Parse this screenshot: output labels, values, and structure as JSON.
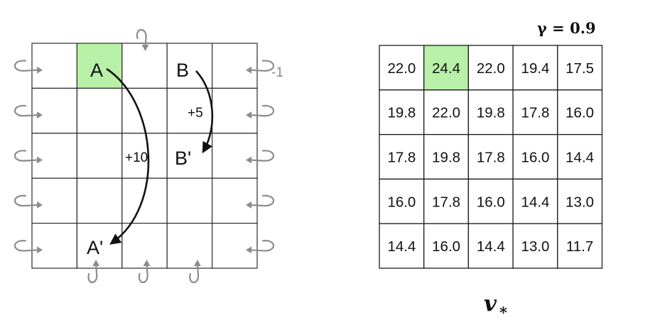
{
  "gridworld": {
    "rows": 5,
    "cols": 5,
    "special_cell": {
      "row": 0,
      "col": 1
    },
    "states": [
      {
        "label": "A",
        "row": 0,
        "col": 1
      },
      {
        "label": "B",
        "row": 0,
        "col": 3
      },
      {
        "label": "B'",
        "row": 2,
        "col": 3
      },
      {
        "label": "A'",
        "row": 4,
        "col": 1
      }
    ],
    "rewards": {
      "a_to_a_prime": "+10",
      "b_to_b_prime": "+5",
      "off_grid": "-1"
    },
    "colors": {
      "special_cell": "#b8f0a8",
      "loop_arrow": "#8c8c8c",
      "jump_arrow": "#111111"
    }
  },
  "value_table": {
    "gamma_label": "γ = 0.9",
    "value_label": "v",
    "value_subscript": "*",
    "special_cell": {
      "row": 0,
      "col": 1
    },
    "rows": [
      [
        "22.0",
        "24.4",
        "22.0",
        "19.4",
        "17.5"
      ],
      [
        "19.8",
        "22.0",
        "19.8",
        "17.8",
        "16.0"
      ],
      [
        "17.8",
        "19.8",
        "17.8",
        "16.0",
        "14.4"
      ],
      [
        "16.0",
        "17.8",
        "16.0",
        "14.4",
        "13.0"
      ],
      [
        "14.4",
        "16.0",
        "14.4",
        "13.0",
        "11.7"
      ]
    ]
  }
}
